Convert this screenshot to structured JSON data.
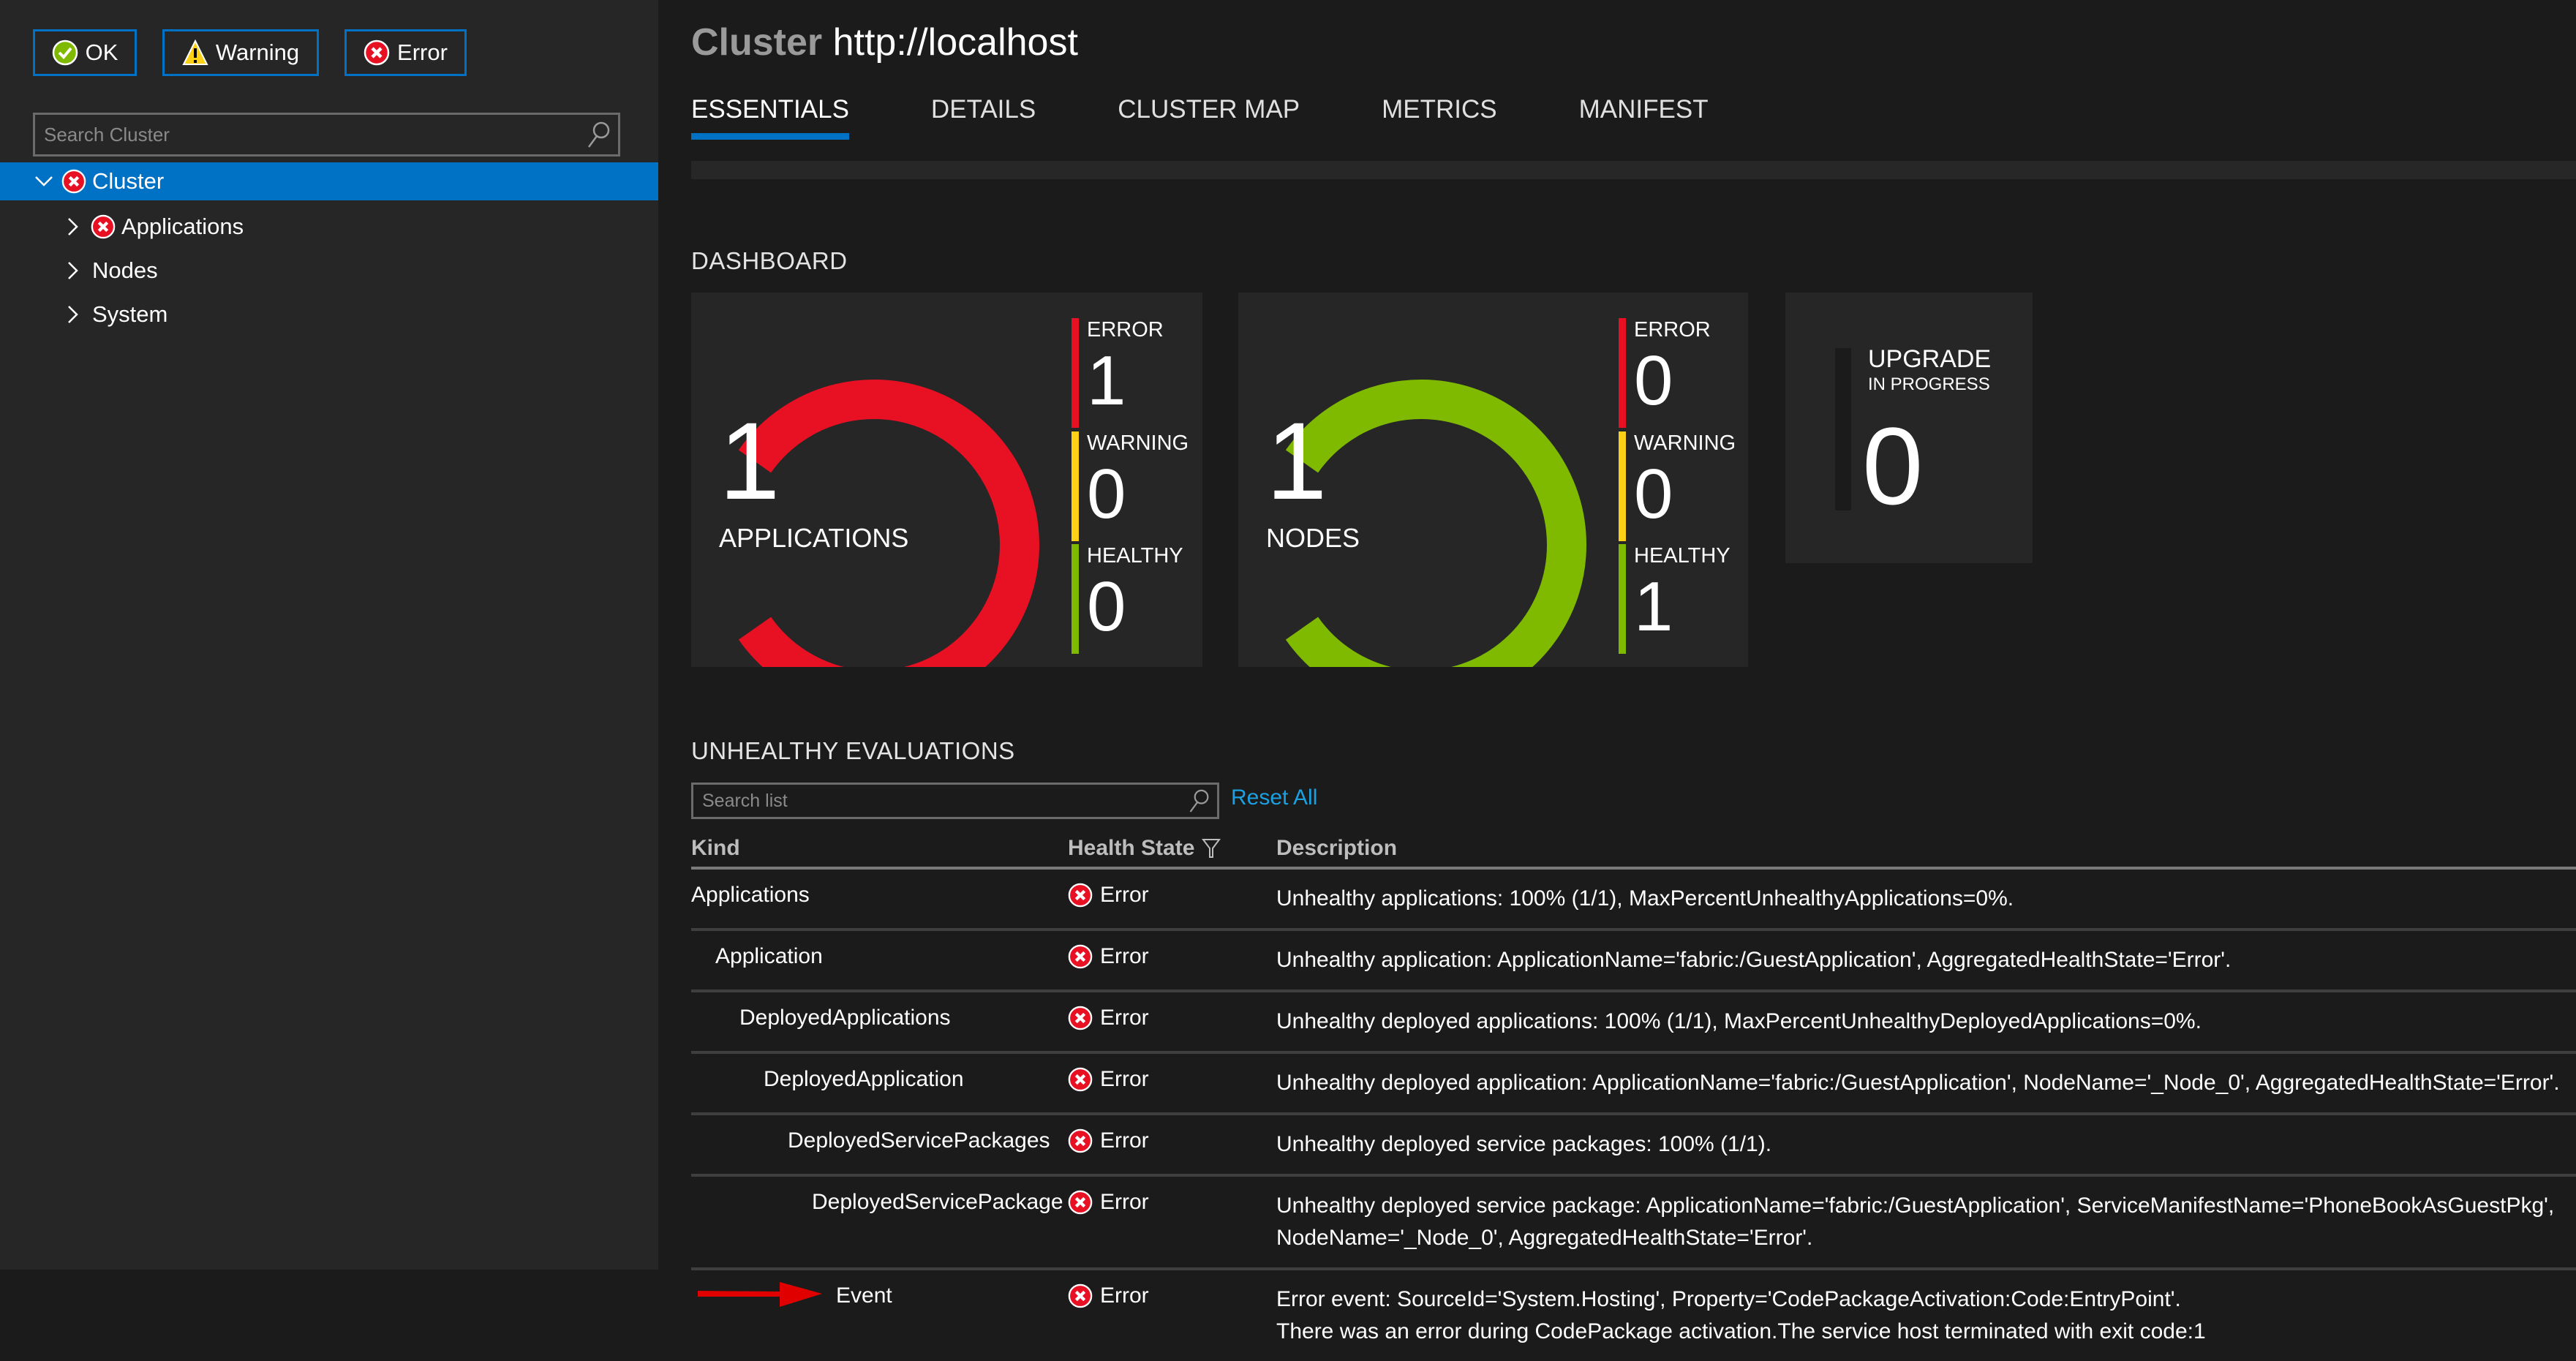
{
  "colors": {
    "accent": "#0072c6",
    "error": "#e81123",
    "warning": "#fcd116",
    "healthy": "#7fba00",
    "link": "#1ba1e2",
    "annotation_arrow": "#e00000"
  },
  "sidebar": {
    "filter_buttons": [
      {
        "label": "OK",
        "icon": "ok-check-icon"
      },
      {
        "label": "Warning",
        "icon": "warning-triangle-icon"
      },
      {
        "label": "Error",
        "icon": "error-x-icon"
      }
    ],
    "search": {
      "placeholder": "Search Cluster",
      "value": ""
    },
    "tree": [
      {
        "label": "Cluster",
        "expanded": true,
        "selected": true,
        "health": "error",
        "depth": 0
      },
      {
        "label": "Applications",
        "expanded": false,
        "selected": false,
        "health": "error",
        "depth": 1
      },
      {
        "label": "Nodes",
        "expanded": false,
        "selected": false,
        "health": null,
        "depth": 1
      },
      {
        "label": "System",
        "expanded": false,
        "selected": false,
        "health": null,
        "depth": 1
      }
    ]
  },
  "header": {
    "kind": "Cluster",
    "name": "http://localhost"
  },
  "tabs": [
    {
      "label": "ESSENTIALS",
      "active": true
    },
    {
      "label": "DETAILS",
      "active": false
    },
    {
      "label": "CLUSTER MAP",
      "active": false
    },
    {
      "label": "METRICS",
      "active": false
    },
    {
      "label": "MANIFEST",
      "active": false
    }
  ],
  "dashboard": {
    "title": "DASHBOARD",
    "tiles": [
      {
        "count": "1",
        "label": "APPLICATIONS",
        "ring_state": "error",
        "stats": [
          {
            "label": "ERROR",
            "value": "1",
            "state": "error"
          },
          {
            "label": "WARNING",
            "value": "0",
            "state": "warning"
          },
          {
            "label": "HEALTHY",
            "value": "0",
            "state": "healthy"
          }
        ]
      },
      {
        "count": "1",
        "label": "NODES",
        "ring_state": "healthy",
        "stats": [
          {
            "label": "ERROR",
            "value": "0",
            "state": "error"
          },
          {
            "label": "WARNING",
            "value": "0",
            "state": "warning"
          },
          {
            "label": "HEALTHY",
            "value": "1",
            "state": "healthy"
          }
        ]
      }
    ],
    "upgrade": {
      "label": "UPGRADE",
      "sublabel": "IN PROGRESS",
      "value": "0"
    }
  },
  "evaluations": {
    "title": "UNHEALTHY EVALUATIONS",
    "search": {
      "placeholder": "Search list",
      "value": ""
    },
    "reset_label": "Reset All",
    "columns": {
      "kind": "Kind",
      "health": "Health State",
      "description": "Description"
    },
    "rows": [
      {
        "kind": "Applications",
        "depth": 0,
        "health": "Error",
        "description": "Unhealthy applications: 100% (1/1), MaxPercentUnhealthyApplications=0%."
      },
      {
        "kind": "Application",
        "depth": 1,
        "health": "Error",
        "description": "Unhealthy application: ApplicationName='fabric:/GuestApplication', AggregatedHealthState='Error'."
      },
      {
        "kind": "DeployedApplications",
        "depth": 2,
        "health": "Error",
        "description": "Unhealthy deployed applications: 100% (1/1), MaxPercentUnhealthyDeployedApplications=0%."
      },
      {
        "kind": "DeployedApplication",
        "depth": 3,
        "health": "Error",
        "description": "Unhealthy deployed application: ApplicationName='fabric:/GuestApplication', NodeName='_Node_0', AggregatedHealthState='Error'."
      },
      {
        "kind": "DeployedServicePackages",
        "depth": 4,
        "health": "Error",
        "description": "Unhealthy deployed service packages: 100% (1/1)."
      },
      {
        "kind": "DeployedServicePackage",
        "depth": 5,
        "health": "Error",
        "description": "Unhealthy deployed service package: ApplicationName='fabric:/GuestApplication', ServiceManifestName='PhoneBookAsGuestPkg',\nNodeName='_Node_0', AggregatedHealthState='Error'."
      },
      {
        "kind": "Event",
        "depth": 6,
        "health": "Error",
        "highlighted_by_arrow": true,
        "description": "Error event: SourceId='System.Hosting', Property='CodePackageActivation:Code:EntryPoint'.\nThere was an error during CodePackage activation.The service host terminated with exit code:1"
      }
    ]
  }
}
